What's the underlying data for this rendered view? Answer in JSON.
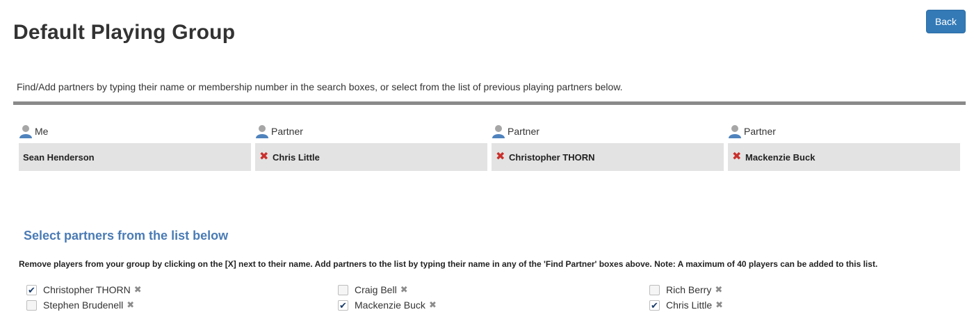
{
  "header": {
    "title": "Default Playing Group",
    "back_label": "Back"
  },
  "intro": "Find/Add partners by typing their name or membership number in the search boxes, or select from the list of previous playing partners below.",
  "slots": [
    {
      "label": "Me",
      "name": "Sean Henderson",
      "removable": false
    },
    {
      "label": "Partner",
      "name": "Chris Little",
      "removable": true
    },
    {
      "label": "Partner",
      "name": "Christopher THORN",
      "removable": true
    },
    {
      "label": "Partner",
      "name": "Mackenzie Buck",
      "removable": true
    }
  ],
  "list_section": {
    "heading": "Select partners from the list below",
    "instructions": "Remove players from your group by clicking on the [X] next to their name. Add partners to the list by typing their name in any of the 'Find Partner' boxes above. Note: A maximum of 40 players can be added to this list.",
    "partners": [
      {
        "name": "Christopher THORN",
        "checked": true
      },
      {
        "name": "Craig Bell",
        "checked": false
      },
      {
        "name": "Rich Berry",
        "checked": false
      },
      {
        "name": "Stephen Brudenell",
        "checked": false
      },
      {
        "name": "Mackenzie Buck",
        "checked": true
      },
      {
        "name": "Chris Little",
        "checked": true
      }
    ]
  },
  "icons": {
    "user": "user-icon",
    "remove": "remove-icon",
    "delete": "delete-x-icon",
    "check": "check-icon"
  },
  "colors": {
    "primary": "#337ab7",
    "heading": "#4a7bb5",
    "remove": "#c9302c",
    "slot_bg": "#e3e3e3",
    "divider": "#8a8a8a"
  }
}
